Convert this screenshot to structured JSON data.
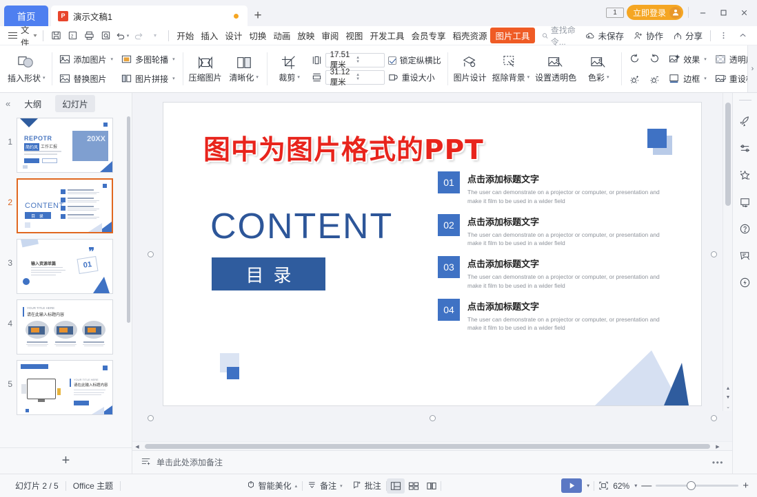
{
  "titlebar": {
    "home_tab": "首页",
    "doc_tab": "演示文稿1",
    "doc_icon": "wps-presentation-icon",
    "new_tab": "+",
    "count_badge": "1",
    "login_label": "立即登录",
    "minimize": "—",
    "maximize": "□",
    "close": "✕"
  },
  "menubar": {
    "file_label": "文件",
    "quick": [
      {
        "name": "save-icon",
        "glyph": "save"
      },
      {
        "name": "export-pdf-icon",
        "glyph": "pdf"
      },
      {
        "name": "print-icon",
        "glyph": "print"
      },
      {
        "name": "print-preview-icon",
        "glyph": "preview"
      },
      {
        "name": "undo-icon",
        "glyph": "undo"
      },
      {
        "name": "redo-icon",
        "glyph": "redo"
      },
      {
        "name": "customize-icon",
        "glyph": "chevron"
      }
    ],
    "tabs": [
      {
        "label": "开始",
        "active": false
      },
      {
        "label": "插入",
        "active": false
      },
      {
        "label": "设计",
        "active": false
      },
      {
        "label": "切换",
        "active": false
      },
      {
        "label": "动画",
        "active": false
      },
      {
        "label": "放映",
        "active": false
      },
      {
        "label": "审阅",
        "active": false
      },
      {
        "label": "视图",
        "active": false
      },
      {
        "label": "开发工具",
        "active": false
      },
      {
        "label": "会员专享",
        "active": false
      },
      {
        "label": "稻壳资源",
        "active": false
      },
      {
        "label": "图片工具",
        "active": true
      }
    ],
    "search_placeholder": "查找命令...",
    "right_items": [
      {
        "label": "未保存",
        "icon": "cloud-unsaved-icon"
      },
      {
        "label": "协作",
        "icon": "collaborate-icon"
      },
      {
        "label": "分享",
        "icon": "share-icon"
      }
    ],
    "more_icon": "more-vertical-icon",
    "collapse_ribbon_icon": "chevron-up-icon"
  },
  "toolbar": {
    "insert_shape": "插入形状",
    "add_picture": "添加图片",
    "replace_picture": "替换图片",
    "multi_carousel": "多图轮播",
    "picture_splice": "图片拼接",
    "compress_picture": "压缩图片",
    "sharpen": "清晰化",
    "crop": "裁剪",
    "height_value": "17.51厘米",
    "width_value": "31.12厘米",
    "lock_aspect": "锁定纵横比",
    "lock_aspect_checked": true,
    "reset_size": "重设大小",
    "picture_design": "图片设计",
    "remove_background": "抠除背景",
    "set_transparent_color": "设置透明色",
    "color": "色彩",
    "rotate_right": "rotate-right-icon",
    "rotate_left": "rotate-left-icon",
    "brightness_up": "brightness-up-icon",
    "brightness_down": "brightness-down-icon",
    "effects": "效果",
    "border": "边框",
    "transparency": "透明度",
    "reset_style": "重设样式",
    "scroll_right": "›"
  },
  "sidebar": {
    "collapse_icon": "«",
    "tab_outline": "大纲",
    "tab_slides": "幻灯片",
    "selected_index": 2,
    "slides": [
      {
        "num": "1",
        "title": "REPOTR",
        "subtitle": "简约风工作汇报",
        "year": "20XX"
      },
      {
        "num": "2",
        "title": "CONTENT",
        "subtitle": "目 录"
      },
      {
        "num": "3",
        "title": "输入资源单篇",
        "badge": "01"
      },
      {
        "num": "4",
        "title": "YOUR TITLE HERE",
        "subtitle": "请在此输入标题内容"
      },
      {
        "num": "5",
        "title": "YOUR TITLE HERE",
        "subtitle": "请在此输入标题内容"
      }
    ],
    "add_slide": "+"
  },
  "slide": {
    "red_banner": "图中为图片格式的PPT",
    "heading_en": "CONTENT",
    "heading_cn": "目录",
    "items": [
      {
        "num": "01",
        "title": "点击添加标题文字",
        "body": "The user can demonstrate on a projector or computer, or presentation and make it film to be used in a wider field"
      },
      {
        "num": "02",
        "title": "点击添加标题文字",
        "body": "The user can demonstrate on a projector or computer, or presentation and make it film to be used in a wider field"
      },
      {
        "num": "03",
        "title": "点击添加标题文字",
        "body": "The user can demonstrate on a projector or computer, or presentation and make it film to be used in a wider field"
      },
      {
        "num": "04",
        "title": "点击添加标题文字",
        "body": "The user can demonstrate on a projector or computer, or presentation and make it film to be used in a wider field"
      }
    ]
  },
  "notes": {
    "placeholder": "单击此处添加备注",
    "add_icon": "add-note-icon",
    "more": "•••"
  },
  "rail": {
    "items": [
      {
        "name": "rocket-icon"
      },
      {
        "name": "sliders-icon"
      },
      {
        "name": "sparkle-star-icon"
      },
      {
        "name": "frame-icon"
      },
      {
        "name": "help-circle-icon"
      },
      {
        "name": "feedback-icon"
      },
      {
        "name": "lightning-icon"
      }
    ]
  },
  "statusbar": {
    "slide_count": "幻灯片 2 / 5",
    "theme": "Office 主题",
    "smart_beautify": "智能美化",
    "notes_btn": "备注",
    "comment_btn": "批注",
    "views": [
      "normal-view-icon",
      "slide-sorter-icon",
      "reading-view-icon"
    ],
    "active_view": 0,
    "play_label": "▶",
    "fit_icon": "fit-to-window-icon",
    "zoom_level": "62%",
    "zoom_out": "—",
    "zoom_in": "+"
  },
  "colors": {
    "accent_blue": "#4e7ff0",
    "brand_orange": "#ef5b25",
    "slide_blue": "#2f5c9e",
    "item_blue": "#3f72c4",
    "red_text": "#e8241c",
    "login_orange": "#f5a623"
  }
}
